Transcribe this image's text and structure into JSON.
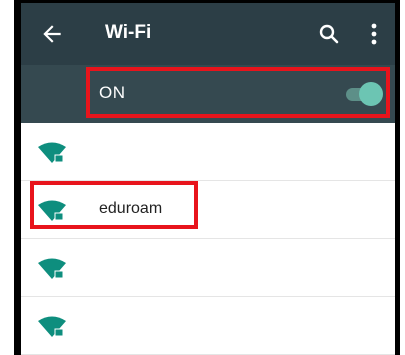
{
  "appbar": {
    "title": "Wi-Fi",
    "back_icon": "arrow-left-icon",
    "search_icon": "search-icon",
    "more_icon": "more-vert-icon"
  },
  "wifi_toggle": {
    "label": "ON",
    "state": "on"
  },
  "networks": [
    {
      "ssid": "",
      "legible": false,
      "icon": "wifi-secured-icon"
    },
    {
      "ssid": "eduroam",
      "legible": true,
      "icon": "wifi-secured-icon"
    },
    {
      "ssid": "",
      "legible": false,
      "icon": "wifi-secured-icon"
    },
    {
      "ssid": "",
      "legible": false,
      "icon": "wifi-secured-icon"
    }
  ],
  "colors": {
    "appbar": "#2c3e46",
    "onbar": "#354950",
    "accent": "#6cc5b3",
    "wifi_icon": "#0e8e7e",
    "highlight": "#e8141c"
  }
}
